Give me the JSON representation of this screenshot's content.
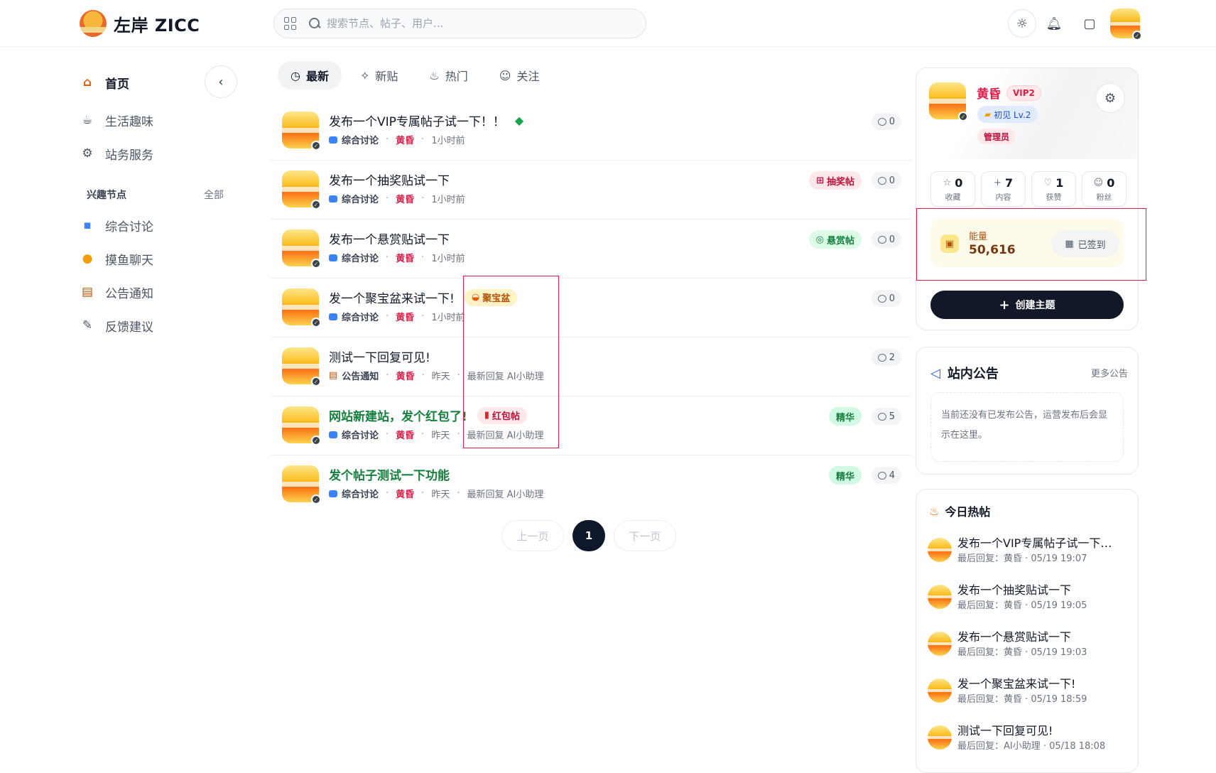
{
  "header": {
    "logo_text": "左岸 ZICC",
    "search_placeholder": "搜索节点、帖子、用户..."
  },
  "sidebar": {
    "main_items": [
      {
        "label": "首页",
        "icon": "house-icon"
      },
      {
        "label": "生活趣味",
        "icon": "cup-icon"
      },
      {
        "label": "站务服务",
        "icon": "service-icon"
      }
    ],
    "section_title": "兴趣节点",
    "section_all": "全部",
    "node_items": [
      {
        "label": "综合讨论",
        "icon": "chat-bubble-icon"
      },
      {
        "label": "摸鱼聊天",
        "icon": "fish-icon"
      },
      {
        "label": "公告通知",
        "icon": "notice-icon"
      },
      {
        "label": "反馈建议",
        "icon": "pen-icon"
      }
    ]
  },
  "tabs": [
    {
      "label": "最新",
      "icon": "clock-icon"
    },
    {
      "label": "新贴",
      "icon": "sparkle-icon"
    },
    {
      "label": "热门",
      "icon": "flame-icon"
    },
    {
      "label": "关注",
      "icon": "users-icon"
    }
  ],
  "posts": [
    {
      "title": "发布一个VIP专属帖子试一下！！",
      "node": "综合讨论",
      "user": "黄昏",
      "time": "1小时前",
      "last_reply": "",
      "comments": "0",
      "tag": "",
      "inline_tag": "",
      "vip_icon": "diamond-icon"
    },
    {
      "title": "发布一个抽奖贴试一下",
      "node": "综合讨论",
      "user": "黄昏",
      "time": "1小时前",
      "last_reply": "",
      "comments": "0",
      "tag": "抽奖帖",
      "inline_tag": ""
    },
    {
      "title": "发布一个悬赏贴试一下",
      "node": "综合讨论",
      "user": "黄昏",
      "time": "1小时前",
      "last_reply": "",
      "comments": "0",
      "tag": "悬赏帖",
      "inline_tag": ""
    },
    {
      "title": "发一个聚宝盆来试一下!",
      "node": "综合讨论",
      "user": "黄昏",
      "time": "1小时前",
      "last_reply": "",
      "comments": "0",
      "tag": "",
      "inline_tag": "聚宝盆"
    },
    {
      "title": "测试一下回复可见!",
      "node": "公告通知",
      "user": "黄昏",
      "time": "昨天",
      "last_reply": "最新回复 AI小助理",
      "comments": "2",
      "tag": "",
      "inline_tag": ""
    },
    {
      "title": "网站新建站，发个红包了!",
      "node": "综合讨论",
      "user": "黄昏",
      "time": "昨天",
      "last_reply": "最新回复 AI小助理",
      "comments": "5",
      "tag": "精华",
      "inline_tag": "红包帖"
    },
    {
      "title": "发个帖子测试一下功能",
      "node": "综合讨论",
      "user": "黄昏",
      "time": "昨天",
      "last_reply": "最新回复 AI小助理",
      "comments": "4",
      "tag": "精华",
      "inline_tag": ""
    }
  ],
  "pagination": {
    "prev": "上一页",
    "current": "1",
    "next": "下一页"
  },
  "profile": {
    "name": "黄昏",
    "vip": "VIP2",
    "level": "初见 Lv.2",
    "role": "管理员",
    "stats": [
      {
        "value": "0",
        "label": "收藏",
        "icon": "star-icon"
      },
      {
        "value": "7",
        "label": "内容",
        "icon": "plus-icon"
      },
      {
        "value": "1",
        "label": "获赞",
        "icon": "heart-icon"
      },
      {
        "value": "0",
        "label": "粉丝",
        "icon": "users-icon"
      }
    ],
    "energy_label": "能量",
    "energy_value": "50,616",
    "checkin_label": "已签到",
    "create_label": "创建主题"
  },
  "notice": {
    "title": "站内公告",
    "more": "更多公告",
    "empty_text": "当前还没有已发布公告，运营发布后会显示在这里。"
  },
  "hot": {
    "title": "今日热帖",
    "items": [
      {
        "title": "发布一个VIP专属帖子试一下…",
        "meta": "最后回复：黄昏 · 05/19 19:07"
      },
      {
        "title": "发布一个抽奖贴试一下",
        "meta": "最后回复：黄昏 · 05/19 19:05"
      },
      {
        "title": "发布一个悬赏贴试一下",
        "meta": "最后回复：黄昏 · 05/19 19:03"
      },
      {
        "title": "发一个聚宝盆来试一下!",
        "meta": "最后回复：黄昏 · 05/19 18:59"
      },
      {
        "title": "测试一下回复可见!",
        "meta": "最后回复：AI小助理 · 05/18 18:08"
      }
    ]
  },
  "colors": {
    "accent": "#111827",
    "user": "#e11d48",
    "featured": "#15803d",
    "highlight_box": "#e11d48"
  }
}
